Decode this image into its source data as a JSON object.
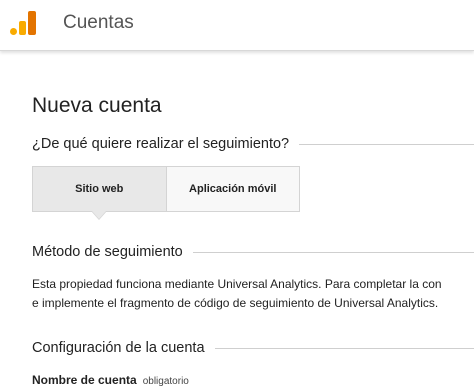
{
  "header": {
    "app_title": "Cuentas",
    "logo_icon": "analytics-logo-icon",
    "colors": {
      "logo_light": "#F9AB00",
      "logo_dark": "#E37400"
    }
  },
  "main": {
    "title": "Nueva cuenta",
    "tracking_question": "¿De qué quiere realizar el seguimiento?",
    "tracking_options": [
      {
        "label": "Sitio web",
        "selected": true
      },
      {
        "label": "Aplicación móvil",
        "selected": false
      }
    ],
    "method_heading": "Método de seguimiento",
    "method_desc_line1": "Esta propiedad funciona mediante Universal Analytics. Para completar la con",
    "method_desc_line2": "e implemente el fragmento de código de seguimiento de Universal Analytics.",
    "config_heading": "Configuración de la cuenta",
    "account_name_label": "Nombre de cuenta",
    "account_name_required": "obligatorio"
  }
}
